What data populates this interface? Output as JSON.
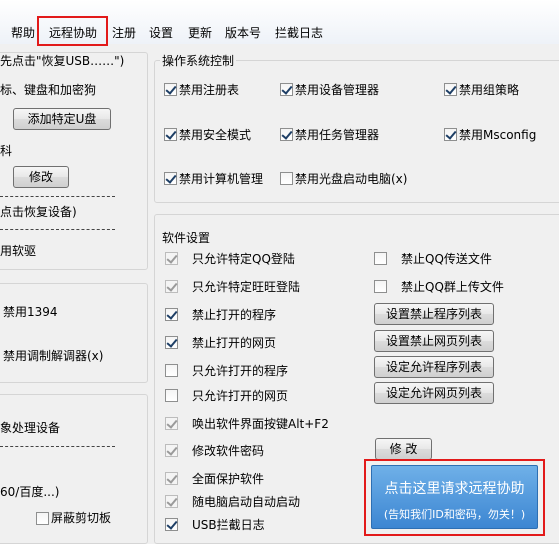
{
  "menu": {
    "items": [
      "帮助",
      "远程协助",
      "注册",
      "设置",
      "更新",
      "版本号",
      "拦截日志"
    ]
  },
  "left_panel": {
    "hint_text": "先点击\"恢复USB……\")",
    "mouse_keyboard_text": "标、键盘和加密狗",
    "add_usb_button": "添加特定U盘",
    "material_text": "科",
    "modify_button": "修改",
    "restore_device_text": "点击恢复设备)",
    "soft_drive_text": "用软驱",
    "disable_1394_text": "禁用1394",
    "disable_modem_text": "禁用调制解调器(x)",
    "image_device_text": "象处理设备",
    "baidu_text": "60/百度...)",
    "block_clipboard_label": "屏蔽剪切板",
    "block_clipboard_checked": false
  },
  "os_control": {
    "title": "操作系统控制",
    "items": [
      {
        "label": "禁用注册表",
        "checked": true
      },
      {
        "label": "禁用设备管理器",
        "checked": true
      },
      {
        "label": "禁用组策略",
        "checked": true
      },
      {
        "label": "禁用安全模式",
        "checked": true
      },
      {
        "label": "禁用任务管理器",
        "checked": true
      },
      {
        "label": "禁用Msconfig",
        "checked": true
      },
      {
        "label": "禁用计算机管理",
        "checked": true
      },
      {
        "label": "禁用光盘启动电脑(x)",
        "checked": false
      }
    ]
  },
  "software": {
    "title": "软件设置",
    "items": [
      {
        "label": "只允许特定QQ登陆",
        "checked": true,
        "disabled": true
      },
      {
        "label": "只允许特定旺旺登陆",
        "checked": true,
        "disabled": true
      },
      {
        "label": "禁止打开的程序",
        "checked": true,
        "disabled": false
      },
      {
        "label": "禁止打开的网页",
        "checked": true,
        "disabled": false
      },
      {
        "label": "只允许打开的程序",
        "checked": false,
        "disabled": false
      },
      {
        "label": "只允许打开的网页",
        "checked": false,
        "disabled": false
      },
      {
        "label": "唤出软件界面按键Alt+F2",
        "checked": true,
        "disabled": true
      },
      {
        "label": "修改软件密码",
        "checked": true,
        "disabled": true
      },
      {
        "label": "全面保护软件",
        "checked": true,
        "disabled": true
      },
      {
        "label": "随电脑启动自动启动",
        "checked": true,
        "disabled": true
      },
      {
        "label": "USB拦截日志",
        "checked": true,
        "disabled": false
      }
    ],
    "right_items": [
      {
        "label": "禁止QQ传送文件",
        "checked": false
      },
      {
        "label": "禁止QQ群上传文件",
        "checked": false
      }
    ],
    "buttons": {
      "set_block_programs": "设置禁止程序列表",
      "set_block_pages": "设置禁止网页列表",
      "set_allow_programs": "设定允许程序列表",
      "set_allow_pages": "设定允许网页列表",
      "modify": "修 改"
    }
  },
  "remote_help": {
    "title": "点击这里请求远程协助",
    "subtitle": "(告知我们ID和密码，勿关！)"
  }
}
